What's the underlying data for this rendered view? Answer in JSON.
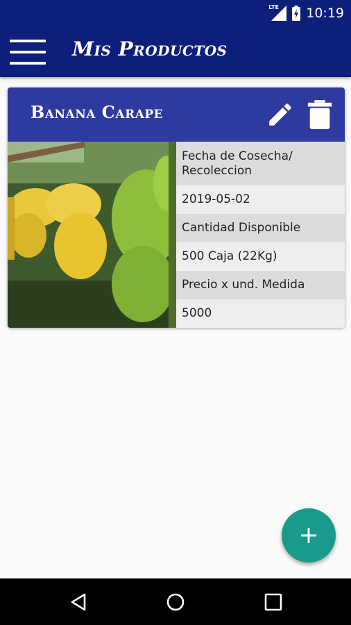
{
  "status_bar": {
    "network_label": "LTE",
    "time": "10:19",
    "icons": [
      "lte-signal-icon",
      "battery-charging-icon"
    ]
  },
  "app_bar": {
    "title": "Mis Productos",
    "menu_icon": "hamburger-menu-icon"
  },
  "product_card": {
    "name": "Banana Carape",
    "actions": [
      "edit-icon",
      "delete-icon"
    ],
    "image": "banana-bunches-photo",
    "details": [
      {
        "label": "Fecha de Cosecha/ Recoleccion",
        "value": "2019-05-02"
      },
      {
        "label": "Cantidad Disponible",
        "value": "500 Caja (22Kg)"
      },
      {
        "label": "Precio x und. Medida",
        "value": "5000"
      }
    ]
  },
  "fab": {
    "icon": "plus-icon",
    "color": "#1a9a8a"
  },
  "nav_bar": {
    "icons": [
      "back-icon",
      "home-icon",
      "recents-icon"
    ]
  },
  "colors": {
    "primary": "#0d1f7a",
    "card_header": "#2e3a9f",
    "accent": "#1a9a8a"
  }
}
